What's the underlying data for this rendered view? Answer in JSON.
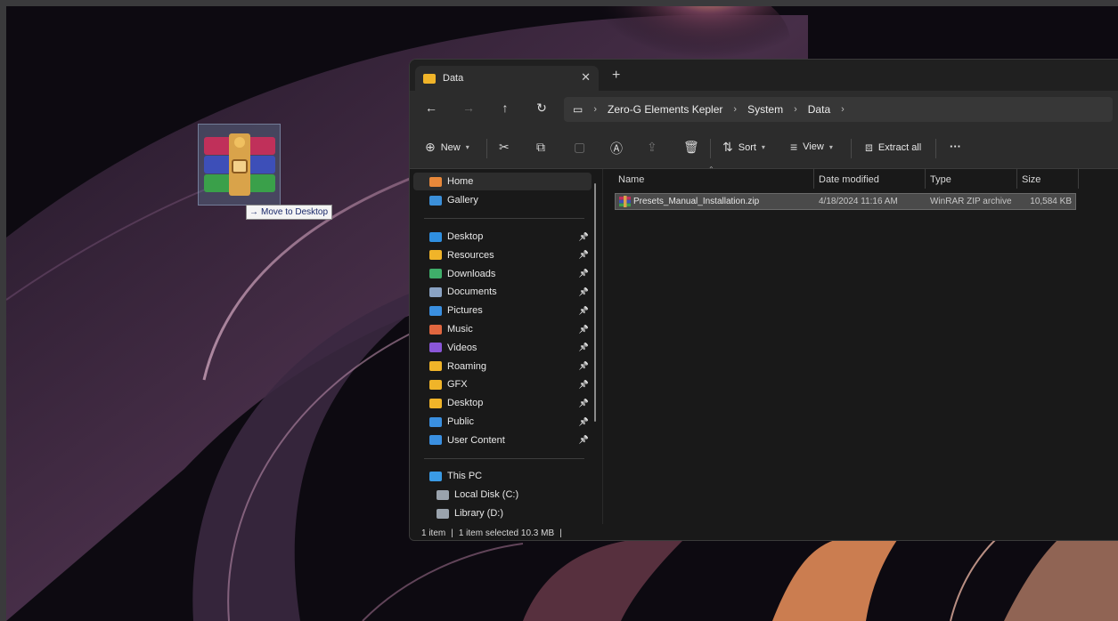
{
  "drag": {
    "tooltip_label": "Move to Desktop",
    "icon": "winrar-archive-icon"
  },
  "window": {
    "tab_title": "Data",
    "new_tab_label": "+",
    "close_label": "✕"
  },
  "address": {
    "crumbs": [
      "Zero-G Elements Kepler",
      "System",
      "Data"
    ]
  },
  "commands": {
    "new_label": "New",
    "sort_label": "Sort",
    "view_label": "View",
    "extract_label": "Extract all",
    "more_label": "···"
  },
  "sidebar": {
    "top": [
      {
        "label": "Home",
        "icon": "home-icon",
        "color": "#e8883a"
      },
      {
        "label": "Gallery",
        "icon": "gallery-icon",
        "color": "#3b8fd9"
      }
    ],
    "quick": [
      {
        "label": "Desktop",
        "icon": "desktop-icon",
        "color": "#2f8fe0"
      },
      {
        "label": "Resources",
        "icon": "folder-icon",
        "color": "#f0b429"
      },
      {
        "label": "Downloads",
        "icon": "download-icon",
        "color": "#3fae6a"
      },
      {
        "label": "Documents",
        "icon": "documents-icon",
        "color": "#8aa3c4"
      },
      {
        "label": "Pictures",
        "icon": "pictures-icon",
        "color": "#3a8fe0"
      },
      {
        "label": "Music",
        "icon": "music-icon",
        "color": "#e0663f"
      },
      {
        "label": "Videos",
        "icon": "videos-icon",
        "color": "#8a56d8"
      },
      {
        "label": "Roaming",
        "icon": "folder-icon",
        "color": "#f0b429"
      },
      {
        "label": "GFX",
        "icon": "folder-icon",
        "color": "#f0b429"
      },
      {
        "label": "Desktop",
        "icon": "folder-icon",
        "color": "#f0b429"
      },
      {
        "label": "Public",
        "icon": "folder-icon",
        "color": "#3a8fe0"
      },
      {
        "label": "User Content",
        "icon": "folder-icon",
        "color": "#3a8fe0"
      }
    ],
    "pc": [
      {
        "label": "This PC",
        "icon": "this-pc-icon",
        "color": "#3a9be6"
      },
      {
        "label": "Local Disk (C:)",
        "icon": "drive-icon",
        "color": "#9aa3ad"
      },
      {
        "label": "Library (D:)",
        "icon": "drive-icon",
        "color": "#9aa3ad"
      }
    ]
  },
  "files": {
    "columns": [
      "Name",
      "Date modified",
      "Type",
      "Size"
    ],
    "rows": [
      {
        "name": "Presets_Manual_Installation.zip",
        "date": "4/18/2024 11:16 AM",
        "type": "WinRAR ZIP archive",
        "size": "10,584 KB"
      }
    ]
  },
  "status": {
    "count": "1 item",
    "selection": "1 item selected 10.3 MB"
  },
  "colors": {
    "window_bg": "#191919",
    "toolbar_bg": "#2c2c2c",
    "accent": "#f0b429",
    "wallpaper_glow": "#f0a070"
  }
}
